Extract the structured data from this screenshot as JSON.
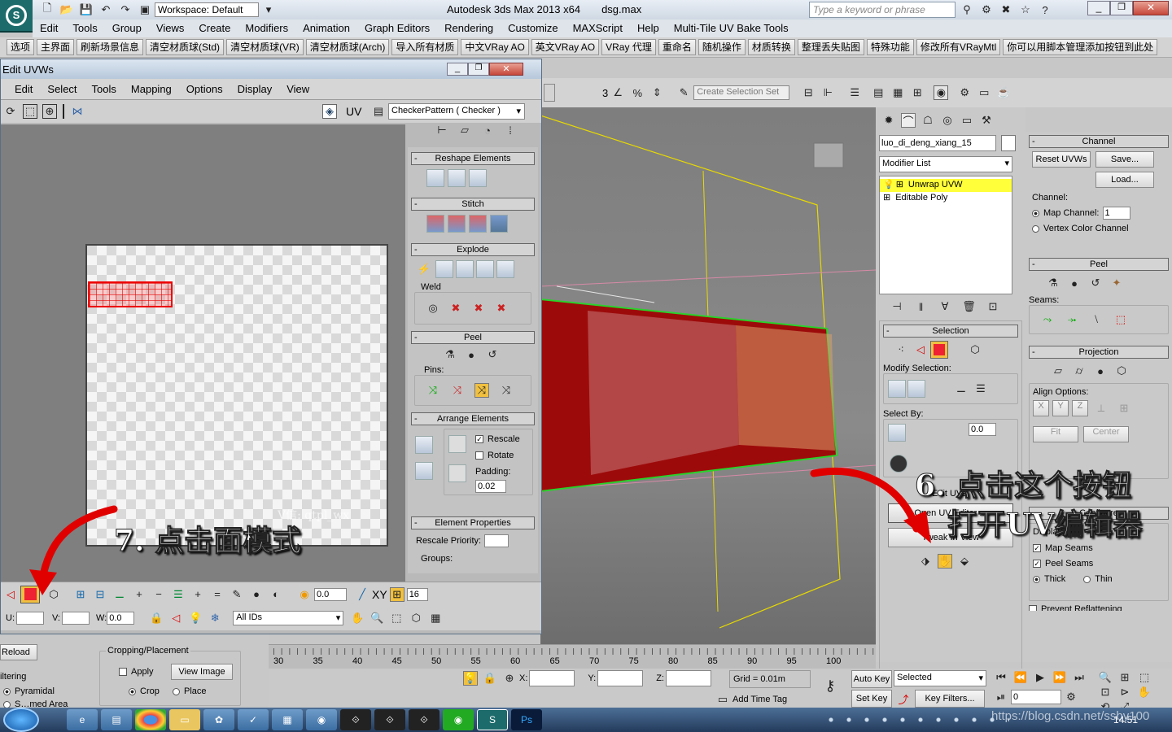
{
  "titlebar": {
    "workspace": "Workspace: Default",
    "app_title": "Autodesk 3ds Max  2013 x64",
    "file": "dsg.max",
    "search_placeholder": "Type a keyword or phrase"
  },
  "menu": [
    "Edit",
    "Tools",
    "Group",
    "Views",
    "Create",
    "Modifiers",
    "Animation",
    "Graph Editors",
    "Rendering",
    "Customize",
    "MAXScript",
    "Help",
    "Multi-Tile UV Bake Tools"
  ],
  "custom_toolbar": [
    "选项",
    "主界面",
    "刷新场景信息",
    "清空材质球(Std)",
    "清空材质球(VR)",
    "清空材质球(Arch)",
    "导入所有材质",
    "中文VRay AO",
    "英文VRay AO",
    "VRay 代理",
    "重命名",
    "随机操作",
    "材质转换",
    "整理丢失贴图",
    "特殊功能",
    "修改所有VRayMtl",
    "你可以用脚本管理添加按钮到此处"
  ],
  "main_toolbar": {
    "numbers": [
      "3",
      "%"
    ],
    "selection_set": "Create Selection Set"
  },
  "uvw_window": {
    "title": "Edit UVWs",
    "menu": [
      "Edit",
      "Select",
      "Tools",
      "Mapping",
      "Options",
      "Display",
      "View"
    ],
    "uv_label": "UV",
    "map_dropdown": "CheckerPattern  ( Checker )",
    "watermark": "V信: qtpl_wx",
    "rollouts": {
      "reshape": "Reshape Elements",
      "stitch": "Stitch",
      "explode": "Explode",
      "weld": "Weld",
      "peel": "Peel",
      "pins": "Pins:",
      "arrange": "Arrange Elements",
      "rescale": "Rescale",
      "rotate": "Rotate",
      "padding": "Padding:",
      "padding_value": "0.02",
      "element_props": "Element Properties",
      "rescale_priority": "Rescale Priority:",
      "groups": "Groups:"
    },
    "bottom": {
      "value": "0.0",
      "xy": "XY",
      "grid_num": "16",
      "u": "U:",
      "v": "V:",
      "w": "W:",
      "w_val": "0.0",
      "ids": "All IDs"
    }
  },
  "left_under": {
    "reload": "Reload",
    "filtering": "iltering",
    "pyramidal": "Pyramidal",
    "summed": "S…med Area",
    "cropping": "Cropping/Placement",
    "apply": "Apply",
    "view_image": "View Image",
    "crop": "Crop",
    "place": "Place"
  },
  "command_panel": {
    "object_name": "luo_di_deng_xiang_15",
    "modifier_list": "Modifier List",
    "stack": [
      "Unwrap UVW",
      "Editable Poly"
    ],
    "selection": "Selection",
    "modify_selection": "Modify Selection:",
    "select_by": "Select By:",
    "select_val": "0.0",
    "edit_uvs": "Edit UVs",
    "open_uv_editor": "Open UV Editor ...",
    "tweak_in_view": "Tweak In View"
  },
  "right_panel": {
    "channel": "Channel",
    "reset_uvws": "Reset UVWs",
    "save": "Save...",
    "load": "Load...",
    "channel_label": "Channel:",
    "map_channel": "Map Channel:",
    "map_channel_val": "1",
    "vertex_color": "Vertex Color Channel",
    "peel": "Peel",
    "seams": "Seams:",
    "projection": "Projection",
    "align_options": "Align Options:",
    "align_xyz": [
      "X",
      "Y",
      "Z"
    ],
    "fit": "Fit",
    "center": "Center",
    "configure": "Configure",
    "display": "Display:",
    "map_seams": "Map Seams",
    "peel_seams": "Peel Seams",
    "thick": "Thick",
    "thin": "Thin",
    "prevent": "Prevent Reflattening"
  },
  "timeline": {
    "ticks": [
      "30",
      "35",
      "40",
      "45",
      "50",
      "55",
      "60",
      "65",
      "70",
      "75",
      "80",
      "85",
      "90",
      "95",
      "100"
    ]
  },
  "status": {
    "x": "X:",
    "y": "Y:",
    "z": "Z:",
    "grid": "Grid = 0.01m",
    "add_time_tag": "Add Time Tag",
    "auto_key": "Auto Key",
    "set_key": "Set Key",
    "selected": "Selected",
    "key_filters": "Key Filters...",
    "frame": "0"
  },
  "annotations": {
    "step6_line1": "6. 点击这个按钮",
    "step6_line2": "打开UV编辑器",
    "step7": "7. 点击面模式"
  },
  "taskbar": {
    "watermark_url": "https://blog.csdn.net/ssby100",
    "clock": "14:51"
  }
}
